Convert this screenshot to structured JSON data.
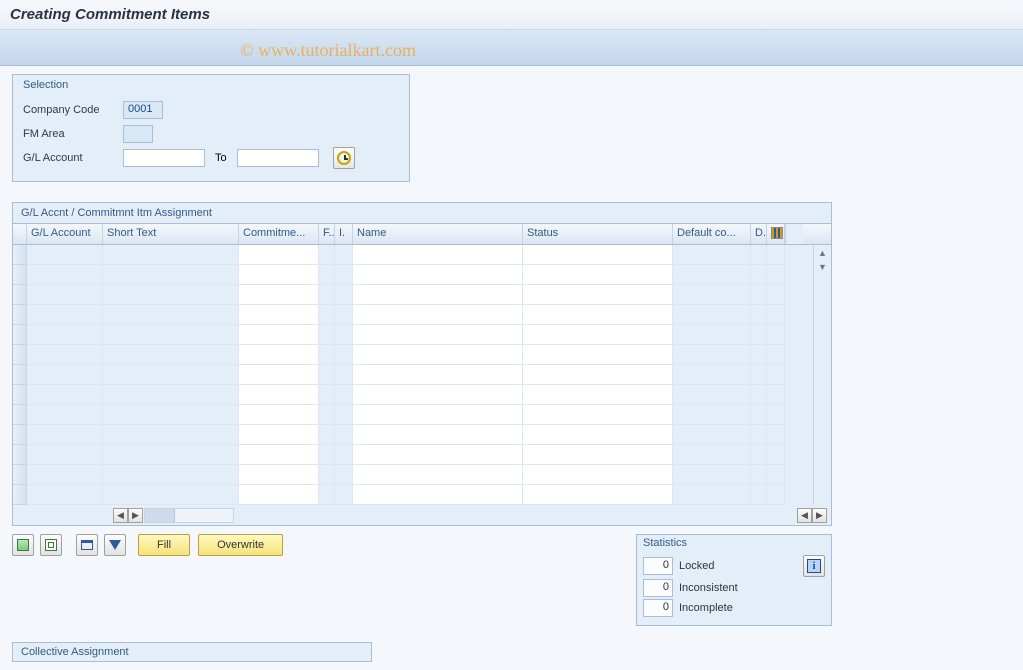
{
  "header": {
    "title": "Creating Commitment Items",
    "watermark": "© www.tutorialkart.com"
  },
  "selection": {
    "title": "Selection",
    "company_code_label": "Company Code",
    "company_code_value": "0001",
    "fm_area_label": "FM Area",
    "fm_area_value": "",
    "gl_account_label": "G/L Account",
    "gl_account_from": "",
    "to_label": "To",
    "gl_account_to": ""
  },
  "table": {
    "title": "G/L Accnt / Commitmnt Itm Assignment",
    "columns": {
      "gl_account": "G/L Account",
      "short_text": "Short Text",
      "commitment": "Commitme...",
      "f": "F..",
      "i": "I.",
      "name": "Name",
      "status": "Status",
      "default_co": "Default co...",
      "d": "D.."
    }
  },
  "buttons": {
    "fill": "Fill",
    "overwrite": "Overwrite"
  },
  "statistics": {
    "title": "Statistics",
    "items": [
      {
        "value": "0",
        "label": "Locked"
      },
      {
        "value": "0",
        "label": "Inconsistent"
      },
      {
        "value": "0",
        "label": "Incomplete"
      }
    ]
  },
  "collective": {
    "title": "Collective Assignment"
  }
}
